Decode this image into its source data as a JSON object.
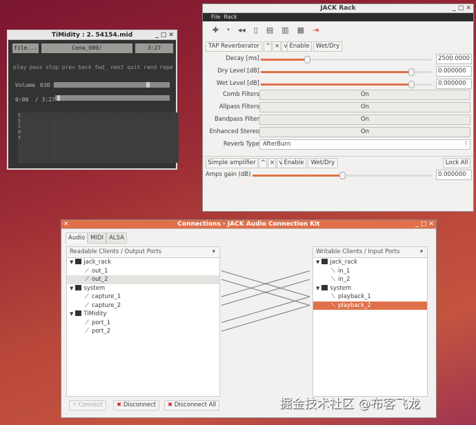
{
  "timidity": {
    "title": "TiMidity : 2. 54154.mid",
    "file_btn": "file...",
    "song": "Cena_000/",
    "time": "3:27",
    "controls": [
      "play",
      "paus",
      "stop",
      "prev",
      "back",
      "fwd_",
      "next",
      "quit",
      "rand",
      "repe"
    ],
    "volume_label": "Volume",
    "volume_value": "630",
    "volume_fraction": 0.82,
    "position": "0:00  / 3:27",
    "position_fraction": 0.02,
    "side_label": "tiles"
  },
  "rack": {
    "title": "JACK Rack",
    "menu": [
      "File",
      "Rack"
    ],
    "plugin1": {
      "name": "TAP Reverberator",
      "up": "^",
      "close": "×",
      "down": "v",
      "enable": "Enable",
      "wetdry": "Wet/Dry",
      "sliders": [
        {
          "label": "Decay [ms]",
          "value": "2500.0000",
          "fraction": 0.27
        },
        {
          "label": "Dry Level [dB]",
          "value": "0.000000",
          "fraction": 0.88
        },
        {
          "label": "Wet Level [dB]",
          "value": "0.000000",
          "fraction": 0.88
        }
      ],
      "toggles": [
        {
          "label": "Comb Filters",
          "value": "On"
        },
        {
          "label": "Allpass Filters",
          "value": "On"
        },
        {
          "label": "Bandpass Filter",
          "value": "On"
        },
        {
          "label": "Enhanced Stereo",
          "value": "On"
        }
      ],
      "reverb_type_label": "Reverb Type",
      "reverb_type": "AfterBurn"
    },
    "plugin2": {
      "name": "Simple amplifier",
      "up": "^",
      "close": "×",
      "down": "v",
      "enable": "Enable",
      "wetdry": "Wet/Dry",
      "lock_all": "Lock All",
      "gain_label": "Amps gain (dB)",
      "gain_value": "0.000000",
      "gain_fraction": 0.5
    }
  },
  "connections": {
    "title": "Connections - JACK Audio Connection Kit",
    "tabs": [
      "Audio",
      "MIDI",
      "ALSA"
    ],
    "left_header": "Readable Clients / Output Ports",
    "right_header": "Writable Clients / Input Ports",
    "left_tree": [
      {
        "client": "jack_rack",
        "ports": [
          "out_1",
          "out_2"
        ]
      },
      {
        "client": "system",
        "ports": [
          "capture_1",
          "capture_2"
        ]
      },
      {
        "client": "TiMidity",
        "ports": [
          "port_1",
          "port_2"
        ]
      }
    ],
    "right_tree": [
      {
        "client": "jack_rack",
        "ports": [
          "in_1",
          "in_2"
        ]
      },
      {
        "client": "system",
        "ports": [
          "playback_1",
          "playback_2"
        ]
      }
    ],
    "links": [
      [
        0,
        2
      ],
      [
        1,
        3
      ],
      [
        2,
        0
      ],
      [
        3,
        1
      ],
      [
        4,
        2
      ],
      [
        5,
        3
      ]
    ],
    "buttons": {
      "connect": "Connect",
      "disconnect": "Disconnect",
      "disconnect_all": "Disconnect All"
    },
    "accent": "#e0704a"
  },
  "watermark": "掘金技术社区 @布客飞龙"
}
